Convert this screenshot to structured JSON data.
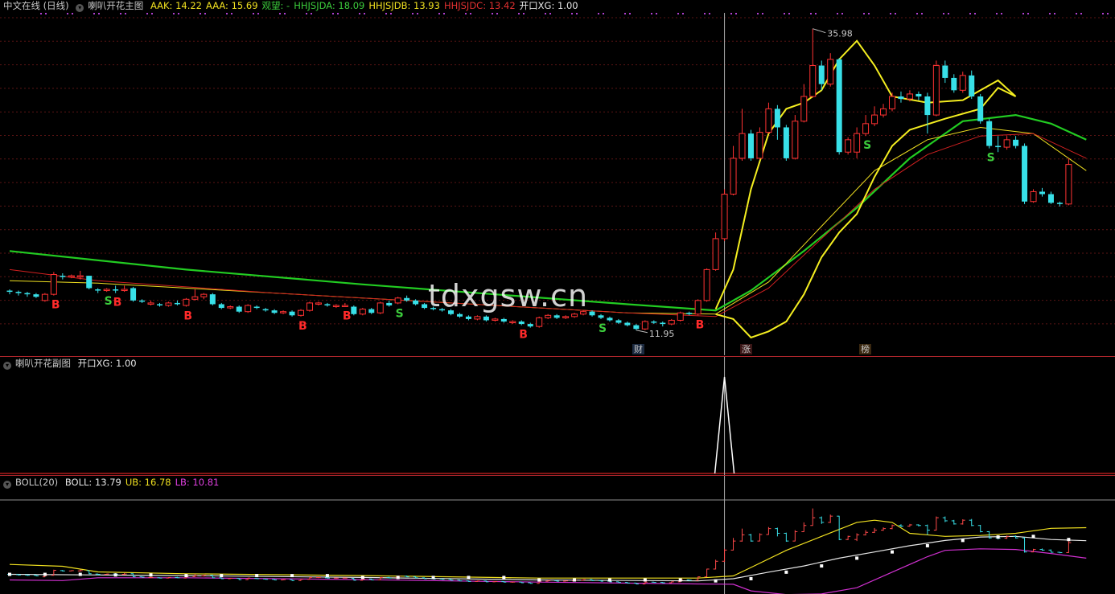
{
  "main_header": {
    "source": "中文在线 (日线)",
    "indicator": "喇叭开花主图",
    "items": [
      {
        "label": "AAK: 14.22",
        "color": "#f0e020"
      },
      {
        "label": "AAA: 15.69",
        "color": "#f0e020"
      },
      {
        "label": "观望: -",
        "color": "#3ccc3c"
      },
      {
        "label": "HHJSJDA: 18.09",
        "color": "#3ccc3c"
      },
      {
        "label": "HHJSJDB: 13.93",
        "color": "#f0e020"
      },
      {
        "label": "HHJSJDC: 13.42",
        "color": "#e03030"
      },
      {
        "label": "开口XG: 1.00",
        "color": "#e6e6e6"
      }
    ]
  },
  "sub_header": {
    "indicator": "喇叭开花副图",
    "value": "开口XG: 1.00"
  },
  "boll_header": {
    "indicator": "BOLL(20)",
    "items": [
      {
        "label": "BOLL: 13.79",
        "color": "#e6e6e6"
      },
      {
        "label": "UB: 16.78",
        "color": "#f0e020"
      },
      {
        "label": "LB: 10.81",
        "color": "#e040e0"
      }
    ]
  },
  "annotations": {
    "high": "35.98",
    "low": "11.95"
  },
  "events": [
    {
      "label": "财",
      "color": "#7fb0ff"
    },
    {
      "label": "涨",
      "color": "#ff6060"
    },
    {
      "label": "榜",
      "color": "#ffb040"
    }
  ],
  "watermark": "tdxgsw.cn",
  "chart_data": {
    "type": "candlestick",
    "price_range": [
      11.0,
      37.0
    ],
    "grid": true,
    "candles": [
      [
        14.8,
        14.7,
        14.9,
        14.5
      ],
      [
        14.7,
        14.6,
        14.8,
        14.4
      ],
      [
        14.6,
        14.5,
        14.7,
        14.3
      ],
      [
        14.5,
        14.3,
        14.6,
        14.2
      ],
      [
        14.0,
        14.5,
        14.6,
        13.9
      ],
      [
        14.5,
        16.1,
        16.3,
        14.4
      ],
      [
        16.0,
        15.9,
        16.2,
        15.7
      ],
      [
        15.9,
        16.0,
        16.1,
        15.8
      ],
      [
        15.9,
        16.0,
        16.4,
        15.7
      ],
      [
        16.0,
        15.0,
        16.0,
        14.9
      ],
      [
        14.9,
        14.8,
        15.0,
        14.6
      ],
      [
        14.8,
        14.9,
        15.0,
        14.7
      ],
      [
        14.9,
        14.8,
        15.2,
        14.6
      ],
      [
        14.8,
        14.9,
        15.2,
        14.7
      ],
      [
        15.0,
        14.0,
        15.1,
        13.9
      ],
      [
        14.0,
        13.9,
        14.1,
        13.8
      ],
      [
        13.8,
        13.8,
        14.0,
        13.6
      ],
      [
        13.7,
        13.6,
        13.8,
        13.5
      ],
      [
        13.6,
        13.8,
        13.9,
        13.5
      ],
      [
        13.8,
        13.7,
        14.0,
        13.6
      ],
      [
        13.6,
        14.1,
        14.2,
        13.5
      ],
      [
        14.1,
        14.3,
        14.9,
        14.0
      ],
      [
        14.3,
        14.5,
        14.6,
        14.1
      ],
      [
        14.5,
        13.7,
        14.6,
        13.6
      ],
      [
        13.7,
        13.4,
        13.8,
        13.3
      ],
      [
        13.4,
        13.5,
        13.6,
        13.3
      ],
      [
        13.5,
        13.1,
        13.6,
        13.0
      ],
      [
        13.1,
        13.6,
        13.7,
        13.0
      ],
      [
        13.5,
        13.4,
        13.6,
        13.3
      ],
      [
        13.3,
        13.2,
        13.4,
        13.1
      ],
      [
        13.2,
        13.0,
        13.3,
        12.9
      ],
      [
        13.0,
        13.1,
        13.2,
        12.9
      ],
      [
        13.1,
        12.8,
        13.2,
        12.7
      ],
      [
        12.8,
        13.2,
        13.3,
        12.7
      ],
      [
        13.2,
        13.8,
        13.9,
        13.1
      ],
      [
        13.8,
        13.8,
        13.9,
        13.6
      ],
      [
        13.7,
        13.6,
        13.8,
        13.5
      ],
      [
        13.6,
        13.6,
        13.7,
        13.4
      ],
      [
        13.6,
        13.6,
        13.8,
        13.5
      ],
      [
        13.5,
        12.9,
        13.6,
        12.8
      ],
      [
        12.9,
        13.3,
        13.4,
        12.8
      ],
      [
        13.3,
        13.0,
        13.4,
        12.9
      ],
      [
        13.0,
        13.8,
        13.9,
        12.9
      ],
      [
        13.8,
        13.6,
        14.0,
        13.5
      ],
      [
        13.8,
        14.2,
        14.3,
        13.7
      ],
      [
        14.2,
        14.0,
        14.4,
        13.9
      ],
      [
        14.0,
        13.7,
        14.1,
        13.6
      ],
      [
        13.7,
        13.4,
        13.8,
        13.3
      ],
      [
        13.4,
        13.3,
        13.5,
        13.2
      ],
      [
        13.3,
        13.2,
        13.4,
        13.1
      ],
      [
        13.2,
        12.9,
        13.3,
        12.8
      ],
      [
        12.9,
        12.7,
        13.0,
        12.6
      ],
      [
        12.7,
        12.5,
        12.8,
        12.4
      ],
      [
        12.5,
        12.7,
        12.8,
        12.4
      ],
      [
        12.7,
        12.4,
        12.8,
        12.3
      ],
      [
        12.4,
        12.5,
        12.6,
        12.3
      ],
      [
        12.5,
        12.3,
        12.6,
        12.2
      ],
      [
        12.3,
        12.3,
        12.4,
        12.1
      ],
      [
        12.3,
        12.1,
        12.4,
        12.0
      ],
      [
        12.1,
        11.9,
        12.2,
        11.8
      ],
      [
        11.9,
        12.6,
        12.7,
        11.8
      ],
      [
        12.6,
        12.8,
        12.9,
        12.5
      ],
      [
        12.8,
        12.6,
        12.9,
        12.5
      ],
      [
        12.6,
        12.7,
        12.8,
        12.5
      ],
      [
        12.7,
        12.9,
        13.0,
        12.6
      ],
      [
        12.9,
        13.1,
        13.2,
        12.8
      ],
      [
        13.1,
        12.8,
        13.2,
        12.7
      ],
      [
        12.8,
        12.6,
        12.9,
        12.5
      ],
      [
        12.6,
        12.4,
        12.7,
        12.3
      ],
      [
        12.4,
        12.2,
        12.5,
        12.1
      ],
      [
        12.2,
        12.0,
        12.3,
        11.9
      ],
      [
        12.0,
        11.7,
        12.1,
        11.6
      ],
      [
        11.7,
        12.3,
        12.4,
        11.6
      ],
      [
        12.3,
        12.2,
        12.4,
        12.1
      ],
      [
        12.2,
        12.1,
        12.3,
        11.9
      ],
      [
        12.1,
        12.4,
        12.5,
        12.0
      ],
      [
        12.4,
        13.0,
        13.1,
        12.3
      ],
      [
        13.0,
        12.9,
        13.1,
        12.8
      ],
      [
        12.9,
        14.0,
        14.1,
        12.8
      ],
      [
        14.0,
        16.5,
        16.6,
        13.9
      ],
      [
        16.5,
        19.0,
        19.5,
        16.4
      ],
      [
        19.0,
        22.6,
        23.0,
        18.8
      ],
      [
        22.6,
        25.5,
        26.5,
        22.5
      ],
      [
        25.5,
        27.5,
        29.5,
        25.3
      ],
      [
        27.5,
        25.5,
        27.8,
        25.3
      ],
      [
        25.5,
        27.6,
        28.0,
        25.4
      ],
      [
        27.6,
        29.5,
        30.0,
        27.5
      ],
      [
        29.5,
        28.0,
        29.8,
        27.0
      ],
      [
        28.0,
        25.5,
        28.2,
        25.3
      ],
      [
        25.5,
        28.5,
        29.0,
        25.4
      ],
      [
        28.5,
        30.5,
        31.5,
        28.4
      ],
      [
        30.5,
        33.0,
        35.98,
        30.4
      ],
      [
        33.0,
        31.5,
        33.4,
        31.0
      ],
      [
        31.5,
        33.5,
        34.0,
        31.3
      ],
      [
        33.5,
        26.0,
        33.6,
        25.8
      ],
      [
        26.0,
        27.0,
        27.2,
        25.8
      ],
      [
        26.0,
        27.5,
        28.0,
        25.5
      ],
      [
        27.5,
        28.3,
        29.0,
        27.3
      ],
      [
        28.3,
        29.0,
        29.7,
        28.1
      ],
      [
        29.0,
        29.5,
        29.9,
        28.8
      ],
      [
        29.5,
        30.5,
        30.8,
        29.3
      ],
      [
        30.5,
        30.3,
        30.9,
        30.0
      ],
      [
        30.3,
        30.7,
        31.0,
        30.1
      ],
      [
        30.7,
        30.5,
        30.9,
        30.2
      ],
      [
        30.5,
        29.0,
        30.8,
        27.5
      ],
      [
        29.0,
        33.0,
        33.4,
        28.9
      ],
      [
        33.0,
        32.0,
        33.4,
        31.6
      ],
      [
        32.0,
        31.0,
        32.3,
        30.8
      ],
      [
        31.0,
        32.2,
        32.5,
        30.8
      ],
      [
        32.2,
        30.5,
        32.6,
        30.3
      ],
      [
        30.5,
        28.5,
        30.7,
        28.3
      ],
      [
        28.5,
        26.5,
        28.7,
        26.3
      ],
      [
        26.5,
        26.4,
        27.3,
        26.0
      ],
      [
        26.4,
        27.0,
        27.3,
        26.2
      ],
      [
        27.0,
        26.5,
        27.3,
        26.3
      ],
      [
        26.5,
        22.0,
        26.7,
        21.8
      ],
      [
        22.0,
        22.8,
        23.0,
        21.9
      ],
      [
        22.8,
        22.6,
        23.1,
        22.4
      ],
      [
        22.6,
        21.9,
        22.8,
        21.8
      ],
      [
        21.9,
        21.8,
        22.0,
        21.6
      ],
      [
        21.8,
        25.0,
        25.5,
        21.7
      ]
    ],
    "signals": [
      {
        "index": 5,
        "label": "B",
        "color": "#ff2a2a"
      },
      {
        "index": 11,
        "label": "S",
        "color": "#3ccc3c"
      },
      {
        "index": 12,
        "label": "B",
        "color": "#ff2a2a"
      },
      {
        "index": 20,
        "label": "B",
        "color": "#ff2a2a"
      },
      {
        "index": 33,
        "label": "B",
        "color": "#ff2a2a"
      },
      {
        "index": 38,
        "label": "B",
        "color": "#ff2a2a"
      },
      {
        "index": 44,
        "label": "S",
        "color": "#3ccc3c"
      },
      {
        "index": 58,
        "label": "B",
        "color": "#ff2a2a"
      },
      {
        "index": 67,
        "label": "S",
        "color": "#3ccc3c"
      },
      {
        "index": 78,
        "label": "B",
        "color": "#ff2a2a"
      },
      {
        "index": 97,
        "label": "S",
        "color": "#3ccc3c"
      },
      {
        "index": 111,
        "label": "S",
        "color": "#3ccc3c"
      }
    ],
    "lines": {
      "green": {
        "color": "#22cc22",
        "points": [
          [
            0,
            18.0
          ],
          [
            20,
            16.5
          ],
          [
            40,
            15.3
          ],
          [
            55,
            14.5
          ],
          [
            70,
            13.7
          ],
          [
            80,
            13.2
          ],
          [
            84,
            14.8
          ],
          [
            90,
            18.0
          ],
          [
            96,
            21.5
          ],
          [
            102,
            25.5
          ],
          [
            108,
            28.5
          ],
          [
            114,
            29.0
          ],
          [
            118,
            28.3
          ],
          [
            122,
            27.0
          ]
        ]
      },
      "yellow_thin": {
        "color": "#f0e020",
        "points": [
          [
            0,
            15.6
          ],
          [
            10,
            15.4
          ],
          [
            30,
            14.6
          ],
          [
            50,
            13.8
          ],
          [
            70,
            13.0
          ],
          [
            80,
            12.9
          ],
          [
            86,
            15.5
          ],
          [
            92,
            20.0
          ],
          [
            98,
            24.5
          ],
          [
            104,
            27.0
          ],
          [
            110,
            28.0
          ],
          [
            116,
            27.5
          ],
          [
            122,
            24.5
          ]
        ]
      },
      "red": {
        "color": "#d02020",
        "points": [
          [
            0,
            16.5
          ],
          [
            10,
            15.6
          ],
          [
            30,
            14.6
          ],
          [
            50,
            13.8
          ],
          [
            70,
            13.0
          ],
          [
            80,
            12.7
          ],
          [
            86,
            15.0
          ],
          [
            92,
            19.0
          ],
          [
            98,
            23.0
          ],
          [
            104,
            25.8
          ],
          [
            110,
            27.3
          ],
          [
            116,
            27.5
          ],
          [
            122,
            25.5
          ]
        ]
      },
      "yellow_upper": {
        "color": "#f4ee20",
        "points": [
          [
            80,
            13.3
          ],
          [
            82,
            16.5
          ],
          [
            84,
            23.0
          ],
          [
            86,
            27.5
          ],
          [
            88,
            29.5
          ],
          [
            90,
            30.0
          ],
          [
            92,
            31.0
          ],
          [
            94,
            33.5
          ],
          [
            96,
            35.0
          ],
          [
            98,
            33.0
          ],
          [
            100,
            30.5
          ],
          [
            104,
            30.0
          ],
          [
            108,
            30.2
          ],
          [
            112,
            31.8
          ],
          [
            114,
            30.5
          ]
        ]
      },
      "yellow_lower": {
        "color": "#f4ee20",
        "points": [
          [
            80,
            12.9
          ],
          [
            82,
            12.5
          ],
          [
            84,
            11.0
          ],
          [
            86,
            11.5
          ],
          [
            88,
            12.3
          ],
          [
            90,
            14.5
          ],
          [
            92,
            17.5
          ],
          [
            94,
            19.5
          ],
          [
            96,
            21.0
          ],
          [
            98,
            24.0
          ],
          [
            100,
            26.5
          ],
          [
            102,
            27.8
          ],
          [
            106,
            28.7
          ],
          [
            110,
            29.5
          ],
          [
            112,
            31.2
          ],
          [
            114,
            30.5
          ]
        ]
      }
    },
    "boll": {
      "range": [
        9.0,
        40.0
      ],
      "mid": {
        "color": "#e6e6e6",
        "points": [
          [
            0,
            14.8
          ],
          [
            10,
            14.6
          ],
          [
            20,
            14.4
          ],
          [
            40,
            13.8
          ],
          [
            60,
            13.0
          ],
          [
            78,
            12.7
          ],
          [
            82,
            13.4
          ],
          [
            86,
            15.5
          ],
          [
            90,
            17.5
          ],
          [
            94,
            20.0
          ],
          [
            98,
            22.0
          ],
          [
            102,
            24.0
          ],
          [
            106,
            25.7
          ],
          [
            110,
            26.8
          ],
          [
            114,
            27.0
          ],
          [
            118,
            26.0
          ],
          [
            122,
            25.6
          ]
        ]
      },
      "ub": {
        "color": "#f0e020",
        "points": [
          [
            0,
            18.0
          ],
          [
            6,
            17.4
          ],
          [
            10,
            15.6
          ],
          [
            20,
            15.0
          ],
          [
            40,
            14.4
          ],
          [
            60,
            13.6
          ],
          [
            78,
            13.6
          ],
          [
            82,
            14.3
          ],
          [
            84,
            17.0
          ],
          [
            88,
            22.5
          ],
          [
            92,
            27.0
          ],
          [
            96,
            31.5
          ],
          [
            98,
            32.2
          ],
          [
            100,
            31.5
          ],
          [
            102,
            28.0
          ],
          [
            106,
            27.0
          ],
          [
            110,
            27.3
          ],
          [
            114,
            28.0
          ],
          [
            118,
            29.6
          ],
          [
            122,
            29.8
          ]
        ]
      },
      "lb": {
        "color": "#d030d0",
        "points": [
          [
            0,
            13.0
          ],
          [
            6,
            12.8
          ],
          [
            10,
            13.7
          ],
          [
            20,
            13.7
          ],
          [
            40,
            13.1
          ],
          [
            60,
            12.3
          ],
          [
            78,
            11.7
          ],
          [
            82,
            11.6
          ],
          [
            84,
            9.5
          ],
          [
            88,
            8.3
          ],
          [
            92,
            8.5
          ],
          [
            96,
            10.5
          ],
          [
            100,
            15.5
          ],
          [
            104,
            20.5
          ],
          [
            106,
            22.5
          ],
          [
            110,
            23.0
          ],
          [
            114,
            22.8
          ],
          [
            118,
            21.5
          ],
          [
            122,
            20.0
          ]
        ]
      }
    },
    "sub_spike": {
      "index": 81,
      "value": 1.0
    }
  }
}
